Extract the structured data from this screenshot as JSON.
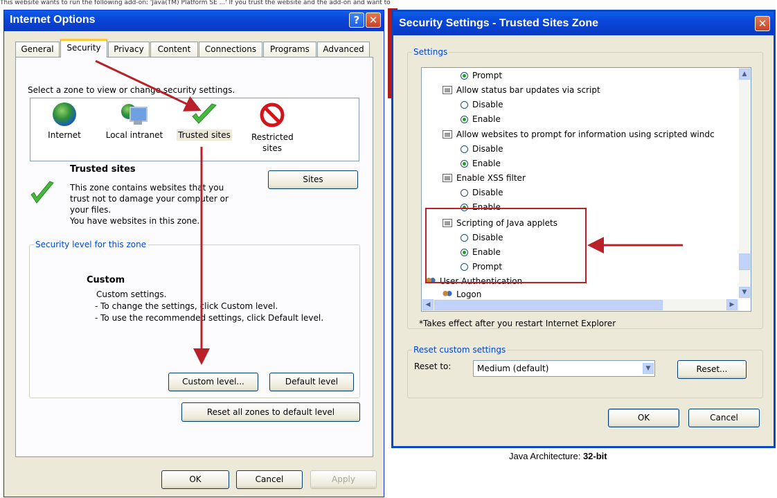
{
  "background_strip": {
    "text": "This website wants to run the following add-on: 'Java(TM) Platform SE ...' If you trust the website and the add-on and want to"
  },
  "internet_options": {
    "title": "Internet Options",
    "help_label": "?",
    "close_label": "✕",
    "tabs": [
      "General",
      "Security",
      "Privacy",
      "Content",
      "Connections",
      "Programs",
      "Advanced"
    ],
    "active_tab": "Security",
    "select_zone_text": "Select a zone to view or change security settings.",
    "zones": [
      {
        "label": "Internet",
        "icon": "globe-icon"
      },
      {
        "label": "Local intranet",
        "icon": "intranet-icon"
      },
      {
        "label": "Trusted sites",
        "icon": "checkmark-icon"
      },
      {
        "label": "Restricted sites",
        "icon": "prohibited-icon"
      }
    ],
    "selected_zone": "Trusted sites",
    "zone_title": "Trusted sites",
    "zone_description": [
      "This zone contains websites that you",
      "trust not to damage your computer or",
      "your files.",
      "You have websites in this zone."
    ],
    "sites_button": "Sites",
    "security_level_legend": "Security level for this zone",
    "level_title": "Custom",
    "level_lines": [
      "Custom settings.",
      "- To change the settings, click Custom level.",
      "- To use the recommended settings, click Default level."
    ],
    "custom_level_button": "Custom level...",
    "default_level_button": "Default level",
    "reset_all_button": "Reset all zones to default level",
    "ok_button": "OK",
    "cancel_button": "Cancel",
    "apply_button": "Apply"
  },
  "security_settings": {
    "title": "Security Settings - Trusted Sites Zone",
    "close_label": "✕",
    "settings_legend": "Settings",
    "list": [
      {
        "kind": "radio",
        "label": "Prompt",
        "checked": true
      },
      {
        "kind": "heading",
        "label": "Allow status bar updates via script"
      },
      {
        "kind": "radio",
        "label": "Disable",
        "checked": false
      },
      {
        "kind": "radio",
        "label": "Enable",
        "checked": true
      },
      {
        "kind": "heading",
        "label": "Allow websites to prompt for information using scripted windc"
      },
      {
        "kind": "radio",
        "label": "Disable",
        "checked": false
      },
      {
        "kind": "radio",
        "label": "Enable",
        "checked": true
      },
      {
        "kind": "heading",
        "label": "Enable XSS filter"
      },
      {
        "kind": "radio",
        "label": "Disable",
        "checked": false
      },
      {
        "kind": "radio",
        "label": "Enable",
        "checked": true
      },
      {
        "kind": "heading",
        "label": "Scripting of Java applets"
      },
      {
        "kind": "radio",
        "label": "Disable",
        "checked": false
      },
      {
        "kind": "radio",
        "label": "Enable",
        "checked": true
      },
      {
        "kind": "radio",
        "label": "Prompt",
        "checked": false
      },
      {
        "kind": "group",
        "label": "User Authentication"
      },
      {
        "kind": "subheading",
        "label": "Logon"
      }
    ],
    "note": "*Takes effect after you restart Internet Explorer",
    "reset_legend": "Reset custom settings",
    "reset_to_label": "Reset to:",
    "reset_select_value": "Medium (default)",
    "reset_button": "Reset...",
    "ok_button": "OK",
    "cancel_button": "Cancel"
  },
  "page_footer": {
    "java_arch_label": "Java Architecture: ",
    "java_arch_value": "32-bit"
  },
  "colors": {
    "xp_blue_title": "#0a46d8",
    "dialog_bg": "#ece9d8",
    "annotation_red": "#b8202a",
    "checked_radio": "#21a121"
  }
}
